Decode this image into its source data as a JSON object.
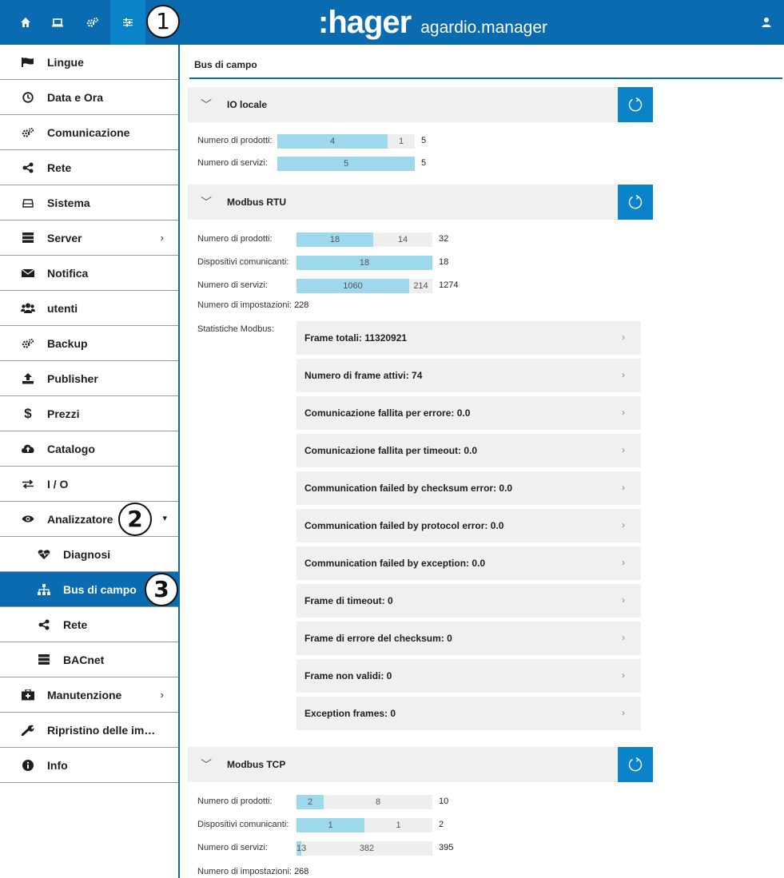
{
  "header": {
    "brand": ":hager",
    "product": "agardio.manager",
    "callout": "1"
  },
  "sidebar": {
    "items": [
      {
        "label": "Lingue",
        "icon": "flag-icon"
      },
      {
        "label": "Data e Ora",
        "icon": "clock-icon"
      },
      {
        "label": "Comunicazione",
        "icon": "gears-icon"
      },
      {
        "label": "Rete",
        "icon": "share-icon"
      },
      {
        "label": "Sistema",
        "icon": "drive-icon"
      },
      {
        "label": "Server",
        "icon": "server-icon",
        "chevron": "›"
      },
      {
        "label": "Notifica",
        "icon": "envelope-icon"
      },
      {
        "label": "utenti",
        "icon": "users-icon"
      },
      {
        "label": "Backup",
        "icon": "gears-icon"
      },
      {
        "label": "Publisher",
        "icon": "upload-icon"
      },
      {
        "label": "Prezzi",
        "icon": "dollar-icon"
      },
      {
        "label": "Catalogo",
        "icon": "cloud-upload-icon"
      },
      {
        "label": "I / O",
        "icon": "arrows-exchange-icon"
      },
      {
        "label": "Analizzatore",
        "icon": "eye-icon",
        "caret": "▾",
        "callout": "2"
      },
      {
        "label": "Diagnosi",
        "icon": "heartbeat-icon",
        "sub": true
      },
      {
        "label": "Bus di campo",
        "icon": "sitemap-icon",
        "sub": true,
        "active": true,
        "callout": "3"
      },
      {
        "label": "Rete",
        "icon": "share-icon",
        "sub": true
      },
      {
        "label": "BACnet",
        "icon": "server-icon",
        "sub": true
      },
      {
        "label": "Manutenzione",
        "icon": "medkit-icon",
        "chevron": "›"
      },
      {
        "label": "Ripristino delle im…",
        "icon": "wrench-icon"
      },
      {
        "label": "Info",
        "icon": "info-icon"
      }
    ]
  },
  "main": {
    "title": "Bus di campo",
    "io_locale": {
      "title": "IO locale",
      "rows": [
        {
          "label": "Numero di prodotti:",
          "a": 4,
          "b": 1,
          "total": 5
        },
        {
          "label": "Numero di servizi:",
          "a": 5,
          "b": 0,
          "total": 5
        }
      ]
    },
    "modbus_rtu": {
      "title": "Modbus RTU",
      "rows": [
        {
          "label": "Numero di prodotti:",
          "a": 18,
          "b": 14,
          "total": 32
        },
        {
          "label": "Dispositivi comunicanti:",
          "a": 18,
          "b": 0,
          "total": 18
        },
        {
          "label": "Numero di servizi:",
          "a": 1060,
          "b": 214,
          "total": 1274
        }
      ],
      "settings_label": "Numero di impostazioni:",
      "settings_value": "228",
      "stats_label": "Statistiche Modbus:",
      "stats": [
        "Frame totali: 11320921",
        "Numero di frame attivi: 74",
        "Comunicazione fallita per errore: 0.0",
        "Comunicazione fallita per timeout: 0.0",
        "Communication failed by checksum error: 0.0",
        "Communication failed by protocol error: 0.0",
        "Communication failed by exception: 0.0",
        "Frame di timeout: 0",
        "Frame di errore del checksum: 0",
        "Frame non validi: 0",
        "Exception frames: 0"
      ]
    },
    "modbus_tcp": {
      "title": "Modbus TCP",
      "rows": [
        {
          "label": "Numero di prodotti:",
          "a": 2,
          "b": 8,
          "total": 10
        },
        {
          "label": "Dispositivi comunicanti:",
          "a": 1,
          "b": 1,
          "total": 2
        },
        {
          "label": "Numero di servizi:",
          "a": 13,
          "b": 382,
          "total": 395
        }
      ],
      "settings_label": "Numero di impostazioni:",
      "settings_value": "268"
    }
  },
  "colors": {
    "primary": "#0a6bb1",
    "accent": "#0a83c9",
    "bar_fill": "#9ed8ec",
    "bar_bg": "#eeeeee"
  }
}
